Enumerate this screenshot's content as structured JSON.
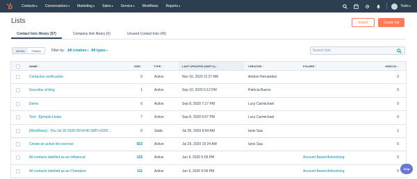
{
  "nav": {
    "items": [
      "Contacts",
      "Conversations",
      "Marketing",
      "Sales",
      "Service",
      "Workflows",
      "Reports"
    ],
    "account": "Tools"
  },
  "page": {
    "title": "Lists"
  },
  "buttons": {
    "import": "Import",
    "create": "Create list"
  },
  "tabs": [
    "Contact lists library (57)",
    "Company lists library (0)",
    "Unused Contact lists (45)"
  ],
  "filters": {
    "toggle": [
      "All lists",
      "Folders"
    ],
    "filter_by": "Filter by:",
    "creators": "All creators",
    "types": "All types",
    "search_placeholder": "Search lists"
  },
  "table": {
    "headers": [
      "NAME",
      "SIZE",
      "TYPE",
      "LAST UPDATED (GMT+1)",
      "CREATOR",
      "FOLDER",
      "USED IN"
    ],
    "rows": [
      {
        "name": "Contactos verificación",
        "size": "0",
        "type": "Active",
        "updated": "Nov 16, 2020 11:27 AM",
        "creator": "Andoni Hernandez",
        "folder": "",
        "used": "0"
      },
      {
        "name": "Suscritos al blog",
        "size": "1",
        "type": "Active",
        "updated": "Sep 10, 2020 6:12 PM",
        "creator": "Patricia Bueno",
        "folder": "",
        "used": "0"
      },
      {
        "name": "Demo",
        "size": "0",
        "type": "Active",
        "updated": "Sep 8, 2020 7:17 PM",
        "creator": "Lucy Carmichael",
        "folder": "",
        "used": "0"
      },
      {
        "name": "Test - Ejemplo Listas",
        "size": "7",
        "type": "Active",
        "updated": "Sep 8, 2020 6:57 PM",
        "creator": "Lucy Carmichael",
        "folder": "",
        "used": "0"
      },
      {
        "name": "[Workflows] - Thu Jul 30 2020 09:54:40 GMT+0200 ...",
        "size": "0",
        "type": "Static",
        "updated": "Jul 30, 2020 9:54 AM",
        "creator": "Ianis Saa",
        "folder": "",
        "used": "1"
      },
      {
        "name": "Create an active list exercise",
        "size": "923",
        "type": "Active",
        "updated": "Jul 29, 2020 10:24 AM",
        "creator": "Ianis Saa",
        "folder": "",
        "used": "0"
      },
      {
        "name": "All contacts labelled as an Influencer",
        "size": "125",
        "type": "Active",
        "updated": "Jun 9, 2020 5:09 PM",
        "creator": "",
        "folder": "Account Based Advertising",
        "used": "0"
      },
      {
        "name": "All contacts labelled as an Champion",
        "size": "111",
        "type": "Active",
        "updated": "Jun 9, 2020 5:09 PM",
        "creator": "",
        "folder": "Account Based Advertising",
        "used": "0"
      }
    ]
  },
  "help": {
    "label": "Help"
  },
  "colors": {
    "nav_bg": "#2d3e50",
    "accent": "#ff7a59",
    "link": "#0091ae",
    "help": "#6a78d1"
  },
  "icons": [
    "hubspot-logo-icon",
    "search-icon",
    "marketplace-icon",
    "settings-icon",
    "notifications-icon",
    "chevron-down-icon"
  ]
}
